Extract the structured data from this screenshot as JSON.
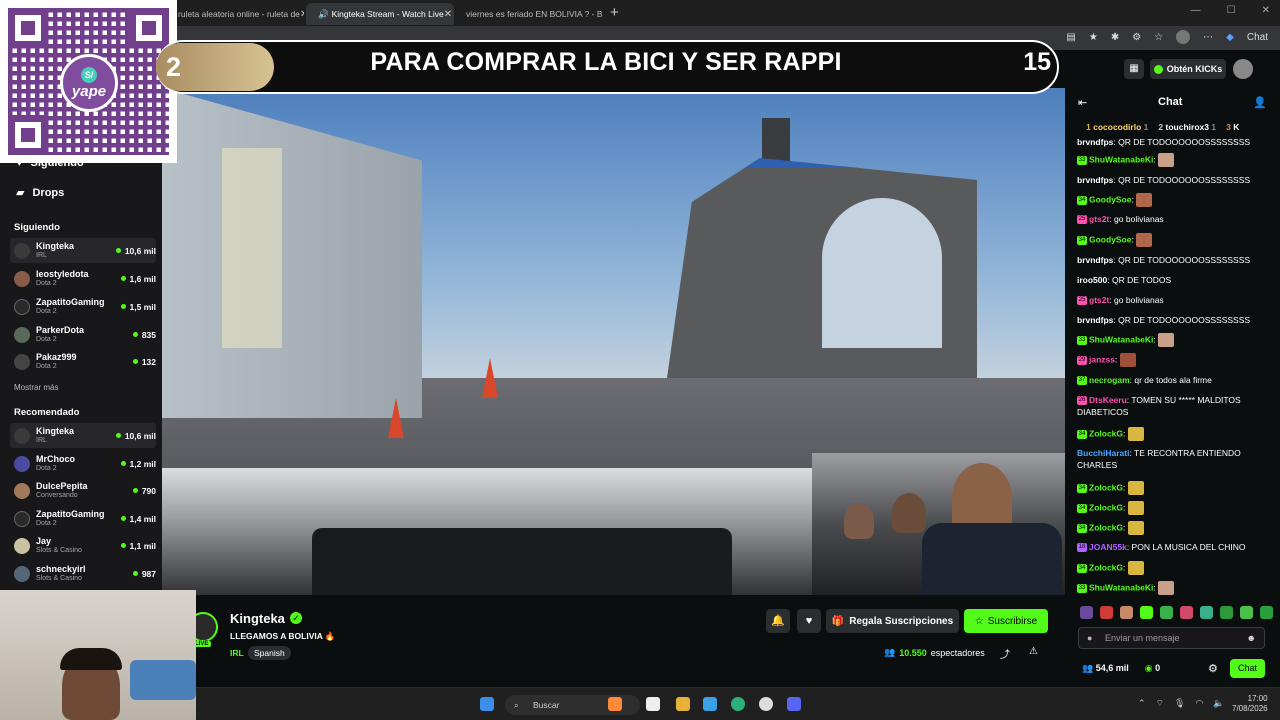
{
  "browser": {
    "tabs": [
      {
        "label": "ruleta aleatoria online - ruleta de"
      },
      {
        "label": "Kingteka Stream - Watch Live"
      },
      {
        "label": "viernes es feriado EN BOLIVIA ? - B"
      }
    ],
    "new_tab": "+",
    "profile_label": "Chat"
  },
  "overlay": {
    "counter_left": "2",
    "banner_text": "PARA COMPRAR LA BICI Y SER RAPPI",
    "counter_right": "15",
    "qr_brand": "yape"
  },
  "sidebar": {
    "following_label": "Siguiendo",
    "drops_label": "Drops",
    "following_title": "Siguiendo",
    "following": [
      {
        "name": "Kingteka",
        "category": "IRL",
        "viewers": "10,6 mil",
        "color": "#3a3a3a"
      },
      {
        "name": "leostyledota",
        "category": "Dota 2",
        "viewers": "1,6 mil",
        "color": "#8a5a4a"
      },
      {
        "name": "ZapatitoGaming",
        "category": "Dota 2",
        "viewers": "1,5 mil",
        "color": "#2a2a2a"
      },
      {
        "name": "ParkerDota",
        "category": "Dota 2",
        "viewers": "835",
        "color": "#5a6a5a"
      },
      {
        "name": "Pakaz999",
        "category": "Dota 2",
        "viewers": "132",
        "color": "#444"
      }
    ],
    "show_more": "Mostrar más",
    "recommended_title": "Recomendado",
    "recommended": [
      {
        "name": "Kingteka",
        "category": "IRL",
        "viewers": "10,6 mil",
        "color": "#3a3a3a"
      },
      {
        "name": "MrChoco",
        "category": "Dota 2",
        "viewers": "1,2 mil",
        "color": "#4a4aa0"
      },
      {
        "name": "DulcePepita",
        "category": "Conversando",
        "viewers": "790",
        "color": "#a07a5a"
      },
      {
        "name": "ZapatitoGaming",
        "category": "Dota 2",
        "viewers": "1,4 mil",
        "color": "#2a2a2a"
      },
      {
        "name": "Jay",
        "category": "Slots & Casino",
        "viewers": "1,1 mil",
        "color": "#c9c2a0"
      },
      {
        "name": "schneckyirl",
        "category": "Slots & Casino",
        "viewers": "987",
        "color": "#556677"
      }
    ]
  },
  "stream": {
    "streamer": "Kingteka",
    "live_badge": "LIVE",
    "title": "LLEGAMOS A BOLIVIA 🔥",
    "category": "IRL",
    "language": "Spanish",
    "gift_label": "Regala Suscripciones",
    "subscribe_label": "Suscribirse",
    "viewers": "10.550",
    "viewers_label": "espectadores"
  },
  "topright": {
    "kicks_label": "Obtén KICKs"
  },
  "chat": {
    "title": "Chat",
    "leaderboard": [
      {
        "rank": "1",
        "name": "cococodirlo",
        "count": "1"
      },
      {
        "rank": "2",
        "name": "touchirox3",
        "count": "1"
      },
      {
        "rank": "3",
        "name": "K",
        "count": ""
      }
    ],
    "messages": [
      {
        "badge": "",
        "user": "brvndfps",
        "user_color": "#ffffff",
        "text": "QR DE TODOOOOOOSSSSSSSS",
        "emote": ""
      },
      {
        "badge": "33",
        "user": "ShuWatanabeKi",
        "user_color": "#53fc18",
        "text": "",
        "emote": "#c9a08a"
      },
      {
        "badge": "",
        "user": "brvndfps",
        "user_color": "#ffffff",
        "text": "QR DE TODOOOOOOSSSSSSSS",
        "emote": ""
      },
      {
        "badge": "34",
        "user": "GoodySoe",
        "user_color": "#53fc18",
        "text": "",
        "emote": "#b0674a"
      },
      {
        "badge": "25",
        "user": "gts2t",
        "user_color": "#ff4fb0",
        "text": "go bolivianas",
        "emote": ""
      },
      {
        "badge": "34",
        "user": "GoodySoe",
        "user_color": "#53fc18",
        "text": "",
        "emote": "#b0674a"
      },
      {
        "badge": "",
        "user": "brvndfps",
        "user_color": "#ffffff",
        "text": "QR DE TODOOOOOOSSSSSSSS",
        "emote": ""
      },
      {
        "badge": "",
        "user": "iroo500",
        "user_color": "#ffffff",
        "text": "QR DE TODOS",
        "emote": ""
      },
      {
        "badge": "25",
        "user": "gts2t",
        "user_color": "#ff4fb0",
        "text": "go bolivianas",
        "emote": ""
      },
      {
        "badge": "",
        "user": "brvndfps",
        "user_color": "#ffffff",
        "text": "QR DE TODOOOOOOSSSSSSSS",
        "emote": ""
      },
      {
        "badge": "33",
        "user": "ShuWatanabeKi",
        "user_color": "#53fc18",
        "text": "",
        "emote": "#c9a08a"
      },
      {
        "badge": "29",
        "user": "janzss",
        "user_color": "#ff4fb0",
        "text": "",
        "emote": "#a0503a"
      },
      {
        "badge": "37",
        "user": "necrogam",
        "user_color": "#53fc18",
        "text": "qr de todos ala firme",
        "emote": ""
      },
      {
        "badge": "26",
        "user": "DtsKeeru",
        "user_color": "#ff4fb0",
        "text": "TOMEN SU ***** MALDITOS DIABETICOS",
        "emote": ""
      },
      {
        "badge": "34",
        "user": "ZolockG",
        "user_color": "#53fc18",
        "text": "",
        "emote": "#d8b640"
      },
      {
        "badge": "",
        "user": "BucchiHarati",
        "user_color": "#4fa8ff",
        "text": "TE RECONTRA ENTIENDO CHARLES",
        "emote": ""
      },
      {
        "badge": "34",
        "user": "ZolockG",
        "user_color": "#53fc18",
        "text": "",
        "emote": "#d8b640"
      },
      {
        "badge": "34",
        "user": "ZolockG",
        "user_color": "#53fc18",
        "text": "",
        "emote": "#d8b640"
      },
      {
        "badge": "34",
        "user": "ZolockG",
        "user_color": "#53fc18",
        "text": "",
        "emote": "#d8b640"
      },
      {
        "badge": "18",
        "user": "JOAN55k",
        "user_color": "#b061ff",
        "text": "PON LA MUSICA DEL CHINO",
        "emote": ""
      },
      {
        "badge": "34",
        "user": "ZolockG",
        "user_color": "#53fc18",
        "text": "",
        "emote": "#d8b640"
      },
      {
        "badge": "33",
        "user": "ShuWatanabeKi",
        "user_color": "#53fc18",
        "text": "",
        "emote": "#c9a08a"
      }
    ],
    "input_placeholder": "Enviar un mensaje",
    "followers": "54,6 mil",
    "kicks": "0",
    "chat_button": "Chat"
  },
  "taskbar": {
    "search_placeholder": "Buscar",
    "time": "17:00",
    "date": "7/08/2026"
  },
  "colors": {
    "kick_green": "#53fc18",
    "background": "#0b0e0f",
    "panel": "#18181b"
  }
}
